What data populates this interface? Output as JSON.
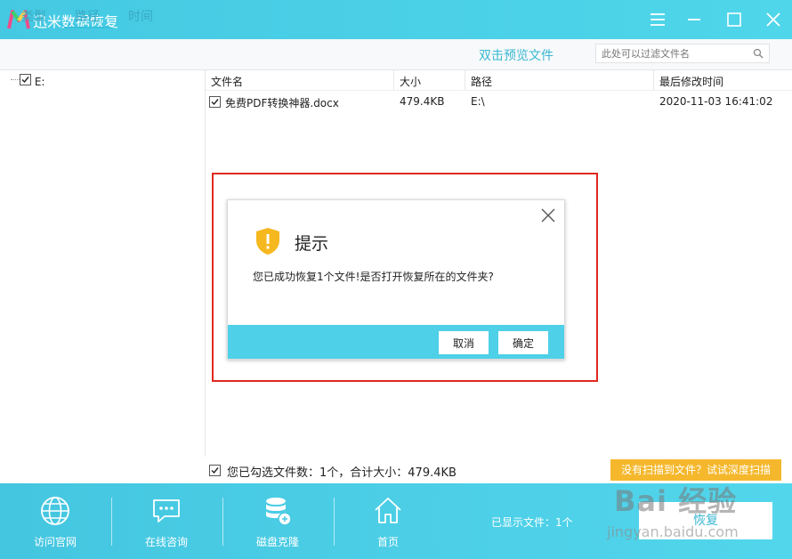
{
  "app": {
    "title": "迅米数据恢复"
  },
  "tabs": [
    {
      "label": "类型"
    },
    {
      "label": "路径"
    },
    {
      "label": "时间"
    }
  ],
  "toolbar": {
    "preview_label": "双击预览文件",
    "search_placeholder": "此处可以过滤文件名"
  },
  "tree": {
    "root_label": "E:"
  },
  "table": {
    "headers": [
      "文件名",
      "大小",
      "路径",
      "最后修改时间"
    ],
    "rows": [
      {
        "name": "免费PDF转换神器.docx",
        "size": "479.4KB",
        "path": "E:\\",
        "modified": "2020-11-03 16:41:02"
      }
    ]
  },
  "dialog": {
    "title": "提示",
    "message": "您已成功恢复1个文件!是否打开恢复所在的文件夹?",
    "cancel_label": "取消",
    "ok_label": "确定"
  },
  "status": {
    "selected_text": "您已勾选文件数：1个，合计大小：479.4KB",
    "deep_scan_label": "没有扫描到文件？试试深度扫描"
  },
  "bottom": {
    "nav": [
      {
        "label": "访问官网",
        "icon": "globe-icon"
      },
      {
        "label": "在线咨询",
        "icon": "chat-icon"
      },
      {
        "label": "磁盘克隆",
        "icon": "disk-icon"
      },
      {
        "label": "首页",
        "icon": "home-icon"
      }
    ],
    "shown_files": "已显示文件：1个",
    "recover_label": "恢复"
  },
  "watermark": {
    "text": "Bai 经验",
    "url": "jingyan.baidu.com"
  },
  "colors": {
    "accent": "#4dd0e8",
    "warning": "#f5b82d",
    "highlight_border": "#e0291f"
  }
}
